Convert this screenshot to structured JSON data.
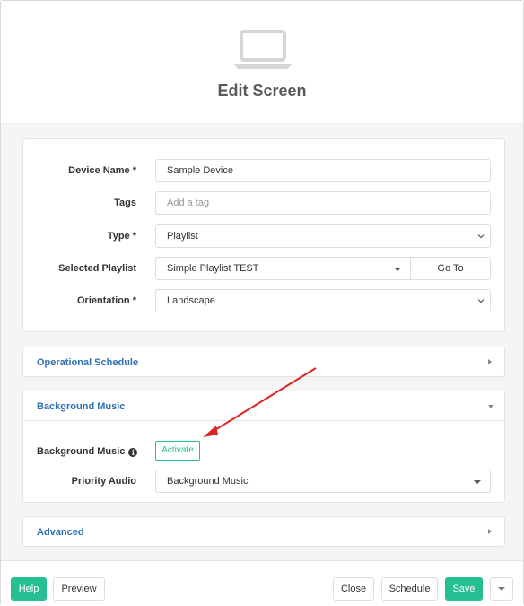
{
  "header": {
    "title": "Edit Screen",
    "icon": "laptop-icon"
  },
  "form": {
    "device_name": {
      "label": "Device Name *",
      "value": "Sample Device"
    },
    "tags": {
      "label": "Tags",
      "placeholder": "Add a tag"
    },
    "type": {
      "label": "Type *",
      "value": "Playlist"
    },
    "selected_playlist": {
      "label": "Selected Playlist",
      "value": "Simple Playlist TEST",
      "goto_label": "Go To"
    },
    "orientation": {
      "label": "Orientation *",
      "value": "Landscape"
    }
  },
  "panels": {
    "operational_schedule": {
      "title": "Operational Schedule",
      "expanded": false
    },
    "background_music": {
      "title": "Background Music",
      "expanded": true,
      "bg_music_label": "Background Music",
      "activate_label": "Activate",
      "priority_audio_label": "Priority Audio",
      "priority_audio_value": "Background Music"
    },
    "advanced": {
      "title": "Advanced",
      "expanded": false
    }
  },
  "footer": {
    "help": "Help",
    "preview": "Preview",
    "close": "Close",
    "schedule": "Schedule",
    "save": "Save"
  },
  "colors": {
    "accent_green": "#26bf94",
    "panel_title_blue": "#2e6fb4",
    "annotation_arrow": "#e02424"
  }
}
